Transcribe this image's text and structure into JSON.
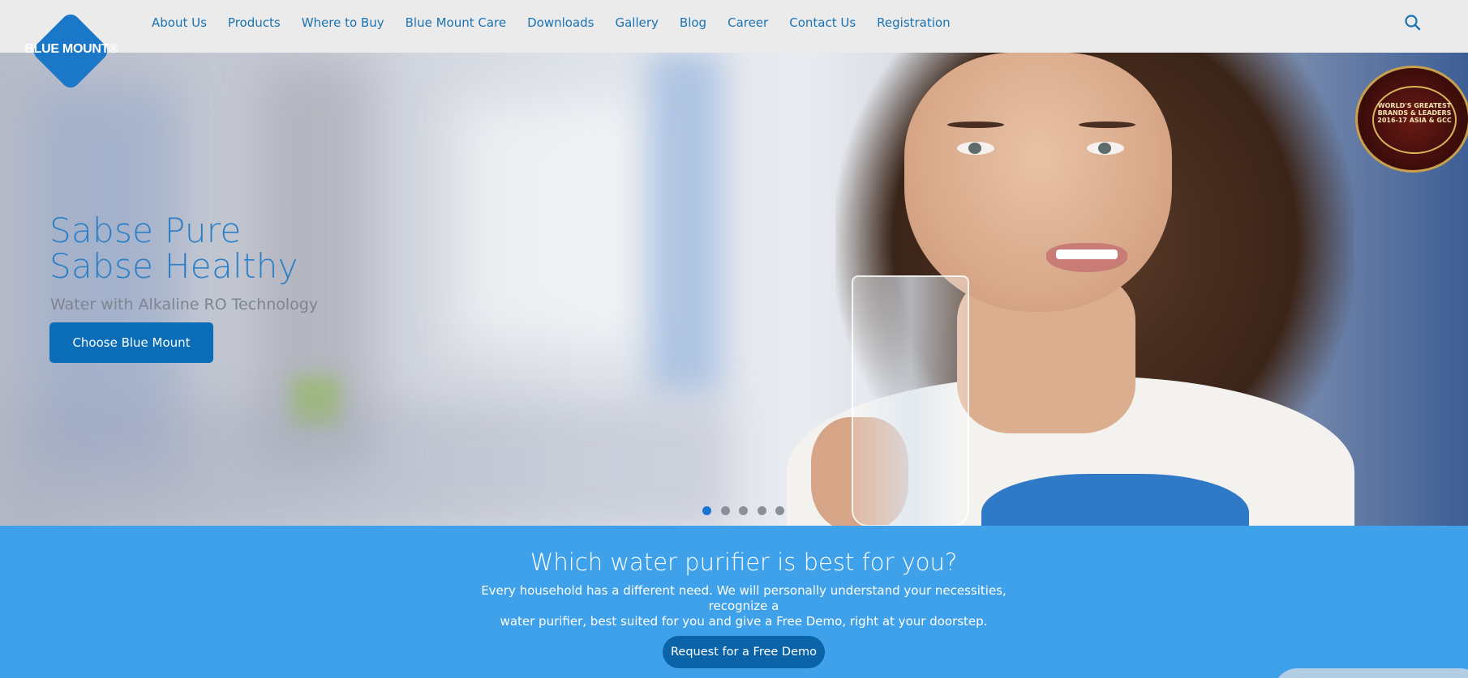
{
  "logo": {
    "text": "BLUE MOUNT®"
  },
  "nav": {
    "items": [
      {
        "label": "About Us"
      },
      {
        "label": "Products"
      },
      {
        "label": "Where to Buy"
      },
      {
        "label": "Blue Mount Care"
      },
      {
        "label": "Downloads"
      },
      {
        "label": "Gallery"
      },
      {
        "label": "Blog"
      },
      {
        "label": "Career"
      },
      {
        "label": "Contact Us"
      },
      {
        "label": "Registration"
      }
    ],
    "search_icon": "search-icon"
  },
  "hero": {
    "title_line1": "Sabse Pure",
    "title_line2": "Sabse Healthy",
    "subtitle": "Water with Alkaline RO Technology",
    "button_label": "Choose Blue Mount",
    "slides_count": 5,
    "active_slide": 1,
    "award_text": "WORLD'S GREATEST BRANDS & LEADERS 2016-17 ASIA & GCC"
  },
  "band": {
    "title": "Which water purifier is best for you?",
    "text_line1": "Every household has a different need. We will personally understand your necessities, recognize a",
    "text_line2": "water purifier, best suited for you and give a Free Demo, right at your doorstep.",
    "button_label": "Request for a Free Demo"
  },
  "colors": {
    "brand_blue": "#1b78c8",
    "nav_text": "#1a73b5",
    "band_bg": "#3fa1ea",
    "button_dark": "#0b6db8"
  }
}
